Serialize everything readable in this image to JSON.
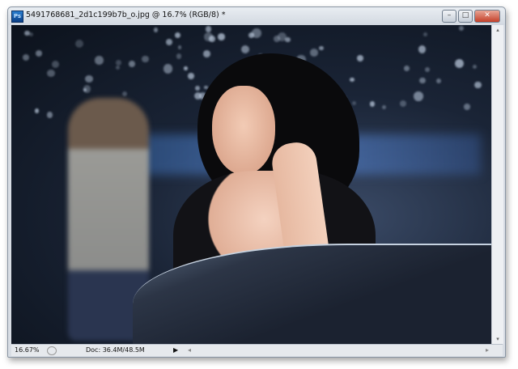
{
  "window": {
    "title": "5491768681_2d1c199b7b_o.jpg @ 16.7% (RGB/8) *",
    "app_icon": "Ps",
    "minimize": "–",
    "maximize": "□",
    "close": "✕"
  },
  "status": {
    "zoom": "16.67%",
    "doc": "Doc: 36.4M/48.5M",
    "menu_arrow": "▶",
    "left_arrow": "◂",
    "right_arrow": "▸"
  },
  "scroll": {
    "up": "▴",
    "down": "▾"
  }
}
